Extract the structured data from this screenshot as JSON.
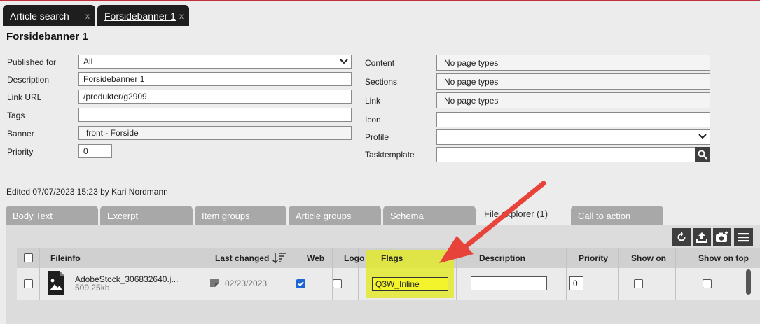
{
  "tabs": [
    {
      "label": "Article search",
      "close": "x"
    },
    {
      "label": "Forsidebanner 1",
      "close": "x"
    }
  ],
  "page_title": "Forsidebanner 1",
  "form_left": {
    "published_for": {
      "label": "Published for",
      "value": "All"
    },
    "description": {
      "label": "Description",
      "value": "Forsidebanner 1"
    },
    "link_url": {
      "label": "Link URL",
      "value": "/produkter/g2909"
    },
    "tags": {
      "label": "Tags",
      "value": ""
    },
    "banner": {
      "label": "Banner",
      "value": "front - Forside"
    },
    "priority": {
      "label": "Priority",
      "value": "0"
    }
  },
  "form_right": {
    "content": {
      "label": "Content",
      "value": "No page types"
    },
    "sections": {
      "label": "Sections",
      "value": "No page types"
    },
    "link": {
      "label": "Link",
      "value": "No page types"
    },
    "icon": {
      "label": "Icon",
      "value": ""
    },
    "profile": {
      "label": "Profile",
      "value": ""
    },
    "tasktemplate": {
      "label": "Tasktemplate",
      "value": ""
    }
  },
  "edited_text": "Edited 07/07/2023 15:23 by Kari Nordmann",
  "subtabs": {
    "body_text": "Body Text",
    "excerpt": "Excerpt",
    "item_groups": "Item groups",
    "article_groups_first": "A",
    "article_groups_rest": "rticle groups",
    "schema_first": "S",
    "schema_rest": "chema",
    "file_explorer_first": "F",
    "file_explorer_rest": "ile explorer (1)",
    "call_to_action_first": "C",
    "call_to_action_rest": "all to action"
  },
  "toolbar_icons": [
    "refresh-icon",
    "upload-icon",
    "camera-icon",
    "menu-icon"
  ],
  "grid": {
    "headers": {
      "fileinfo": "Fileinfo",
      "last_changed": "Last changed",
      "web": "Web",
      "logo": "Logo",
      "flags": "Flags",
      "description": "Description",
      "priority": "Priority",
      "show_on": "Show on",
      "show_on_top": "Show on top"
    },
    "row": {
      "filename": "AdobeStock_306832640.j...",
      "filesize": "509.25kb",
      "last_changed": "02/23/2023",
      "web_checked": true,
      "logo_checked": false,
      "flags": "Q3W_Inline",
      "description": "",
      "priority": "0",
      "show_on_checked": false,
      "show_on_top_checked": false
    }
  },
  "colors": {
    "annotation_arrow": "#e8433a",
    "highlight": "#e2e828",
    "checkbox_accent": "#1a66d6",
    "top_accent": "#c0303a"
  }
}
